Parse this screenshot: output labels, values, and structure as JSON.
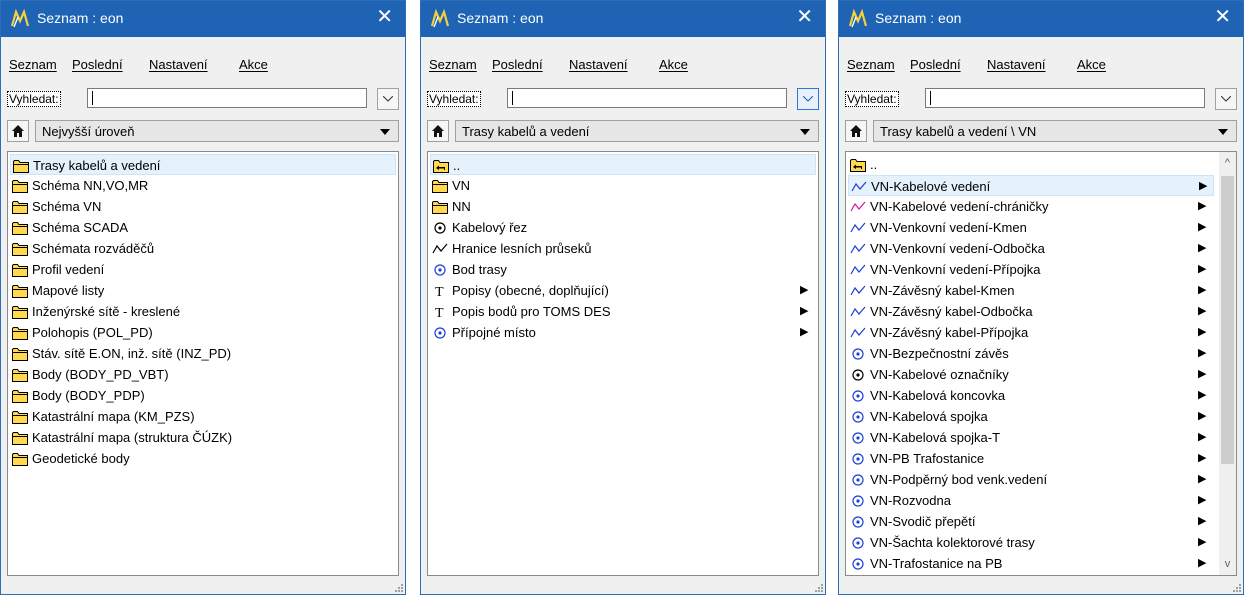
{
  "windows": [
    {
      "title": "Seznam : eon",
      "menu": [
        "Seznam",
        "Poslední",
        "Nastavení",
        "Akce"
      ],
      "search_label": "Vyhledat:",
      "search_value": "",
      "level": "Nejvyšší úroveň",
      "items": [
        {
          "icon": "folder",
          "label": "Trasy kabelů a vedení",
          "selected": true
        },
        {
          "icon": "folder",
          "label": "Schéma NN,VO,MR"
        },
        {
          "icon": "folder",
          "label": "Schéma VN"
        },
        {
          "icon": "folder",
          "label": "Schéma SCADA"
        },
        {
          "icon": "folder",
          "label": "Schémata rozváděčů"
        },
        {
          "icon": "folder",
          "label": "Profil vedení"
        },
        {
          "icon": "folder",
          "label": "Mapové listy"
        },
        {
          "icon": "folder",
          "label": "Inženýrské sítě - kreslené"
        },
        {
          "icon": "folder",
          "label": "Polohopis (POL_PD)"
        },
        {
          "icon": "folder",
          "label": "Stáv. sítě E.ON, inž. sítě (INZ_PD)"
        },
        {
          "icon": "folder",
          "label": "Body (BODY_PD_VBT)"
        },
        {
          "icon": "folder",
          "label": "Body (BODY_PDP)"
        },
        {
          "icon": "folder",
          "label": "Katastrální mapa (KM_PZS)"
        },
        {
          "icon": "folder",
          "label": "Katastrální mapa (struktura ČÚZK)"
        },
        {
          "icon": "folder",
          "label": "Geodetické body"
        }
      ]
    },
    {
      "title": "Seznam : eon",
      "menu": [
        "Seznam",
        "Poslední",
        "Nastavení",
        "Akce"
      ],
      "search_label": "Vyhledat:",
      "search_value": "",
      "level": "Trasy kabelů a vedení",
      "items": [
        {
          "icon": "folder-up",
          "label": "..",
          "selected": true
        },
        {
          "icon": "folder",
          "label": "VN"
        },
        {
          "icon": "folder",
          "label": "NN"
        },
        {
          "icon": "point-black",
          "label": "Kabelový řez"
        },
        {
          "icon": "line-black",
          "label": "Hranice lesních průseků"
        },
        {
          "icon": "point-blue",
          "label": "Bod trasy"
        },
        {
          "icon": "text",
          "label": "Popisy (obecné, doplňující)",
          "submenu": true
        },
        {
          "icon": "text",
          "label": "Popis bodů pro TOMS DES",
          "submenu": true
        },
        {
          "icon": "point-blue",
          "label": "Přípojné místo",
          "submenu": true
        }
      ]
    },
    {
      "title": "Seznam : eon",
      "menu": [
        "Seznam",
        "Poslední",
        "Nastavení",
        "Akce"
      ],
      "search_label": "Vyhledat:",
      "search_value": "",
      "level": "Trasy kabelů a vedení \\ VN",
      "items": [
        {
          "icon": "folder-up",
          "label": ".."
        },
        {
          "icon": "line-blue",
          "label": "VN-Kabelové vedení",
          "submenu": true,
          "selected": true
        },
        {
          "icon": "line-magenta",
          "label": "VN-Kabelové vedení-chráničky",
          "submenu": true
        },
        {
          "icon": "line-blue",
          "label": "VN-Venkovní vedení-Kmen",
          "submenu": true
        },
        {
          "icon": "line-blue",
          "label": "VN-Venkovní vedení-Odbočka",
          "submenu": true
        },
        {
          "icon": "line-blue",
          "label": "VN-Venkovní vedení-Přípojka",
          "submenu": true
        },
        {
          "icon": "line-blue",
          "label": "VN-Závěsný kabel-Kmen",
          "submenu": true
        },
        {
          "icon": "line-blue",
          "label": "VN-Závěsný kabel-Odbočka",
          "submenu": true
        },
        {
          "icon": "line-blue",
          "label": "VN-Závěsný kabel-Přípojka",
          "submenu": true
        },
        {
          "icon": "point-blue",
          "label": "VN-Bezpečnostní závěs",
          "submenu": true
        },
        {
          "icon": "point-black",
          "label": "VN-Kabelové označníky",
          "submenu": true
        },
        {
          "icon": "point-blue",
          "label": "VN-Kabelová koncovka",
          "submenu": true
        },
        {
          "icon": "point-blue",
          "label": "VN-Kabelová spojka",
          "submenu": true
        },
        {
          "icon": "point-blue",
          "label": "VN-Kabelová spojka-T",
          "submenu": true
        },
        {
          "icon": "point-blue",
          "label": "VN-PB Trafostanice",
          "submenu": true
        },
        {
          "icon": "point-blue",
          "label": "VN-Podpěrný bod venk.vedení",
          "submenu": true
        },
        {
          "icon": "point-blue",
          "label": "VN-Rozvodna",
          "submenu": true
        },
        {
          "icon": "point-blue",
          "label": "VN-Svodič přepětí",
          "submenu": true
        },
        {
          "icon": "point-blue",
          "label": "VN-Šachta kolektorové trasy",
          "submenu": true
        },
        {
          "icon": "point-blue",
          "label": "VN-Trafostanice na PB",
          "submenu": true
        }
      ]
    }
  ],
  "colors": {
    "titlebar": "#1f63b4",
    "selection": "#e5f1fb",
    "folder": "#ffd84d",
    "blue": "#1d3fd6",
    "magenta": "#e0189a"
  }
}
